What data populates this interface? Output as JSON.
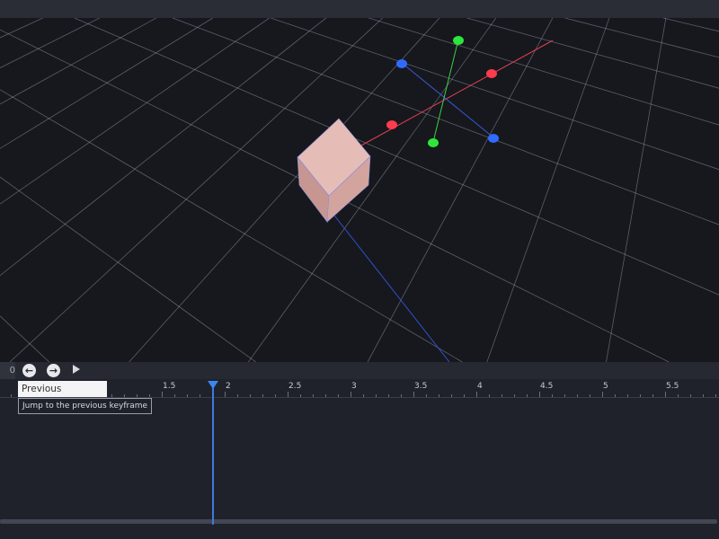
{
  "timeline": {
    "current_time_value": "0",
    "prev_keyframe_icon": "arrow-left-circle-icon",
    "next_keyframe_icon": "arrow-right-circle-icon",
    "play_icon": "play-icon",
    "ruler_labels": [
      "1.5",
      "2",
      "2.5",
      "3",
      "3.5",
      "4",
      "4.5",
      "5",
      "5.5"
    ],
    "ruler_start": 1.5,
    "ruler_step": 0.5,
    "playhead_time": 1.91
  },
  "tooltip": {
    "title": "Previous Keyframe",
    "description": "Jump to the previous keyframe"
  },
  "colors": {
    "x_axis": "#ff3b4e",
    "y_axis": "#2ee63a",
    "z_axis": "#2f6bff",
    "cube": "#d9aaa3",
    "playhead": "#3d86f0"
  }
}
